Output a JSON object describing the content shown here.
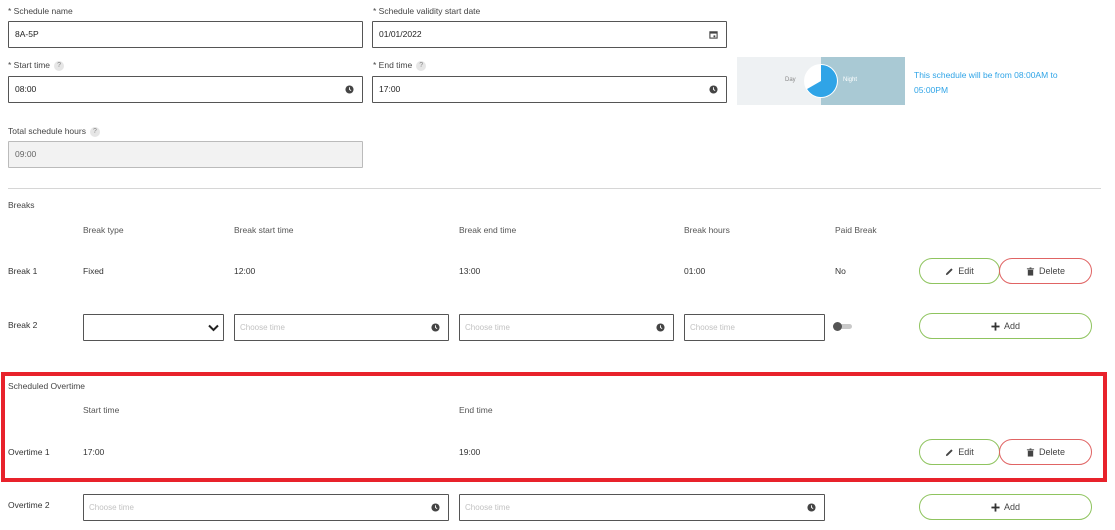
{
  "schedule": {
    "name_label": "* Schedule name",
    "name_value": "8A-5P",
    "validity_label": "* Schedule validity start date",
    "validity_value": "01/01/2022",
    "start_label": "* Start time",
    "start_value": "08:00",
    "end_label": "* End time",
    "end_value": "17:00",
    "total_label": "Total schedule hours",
    "total_value": "09:00",
    "help_glyph": "?",
    "day_label": "Day",
    "night_label": "Night",
    "summary": "This schedule will be from 08:00AM to 05:00PM",
    "colors": {
      "accent": "#2fa4e7",
      "night_bg": "#a9c9d4",
      "day_bg": "#eef1f3"
    }
  },
  "breaks": {
    "section_title": "Breaks",
    "headers": [
      "Break type",
      "Break start time",
      "Break end time",
      "Break hours",
      "Paid Break"
    ],
    "rows": [
      {
        "label": "Break 1",
        "type": "Fixed",
        "start": "12:00",
        "end": "13:00",
        "hours": "01:00",
        "paid": "No"
      }
    ],
    "new_row": {
      "label": "Break 2",
      "start_placeholder": "Choose time",
      "end_placeholder": "Choose time",
      "hours_placeholder": "Choose time"
    }
  },
  "overtime": {
    "section_title": "Scheduled Overtime",
    "headers": [
      "Start time",
      "End time"
    ],
    "rows": [
      {
        "label": "Overtime 1",
        "start": "17:00",
        "end": "19:00"
      }
    ],
    "new_row": {
      "label": "Overtime 2",
      "start_placeholder": "Choose time",
      "end_placeholder": "Choose time"
    },
    "highlight_color": "#e8222b"
  },
  "actions": {
    "edit_label": "Edit",
    "delete_label": "Delete",
    "add_label": "Add"
  },
  "icons": {
    "calendar": "calendar-icon",
    "clock": "clock-icon",
    "chevron": "chevron-down-icon",
    "pencil": "pencil-icon",
    "trash": "trash-icon",
    "plus": "plus-icon"
  }
}
